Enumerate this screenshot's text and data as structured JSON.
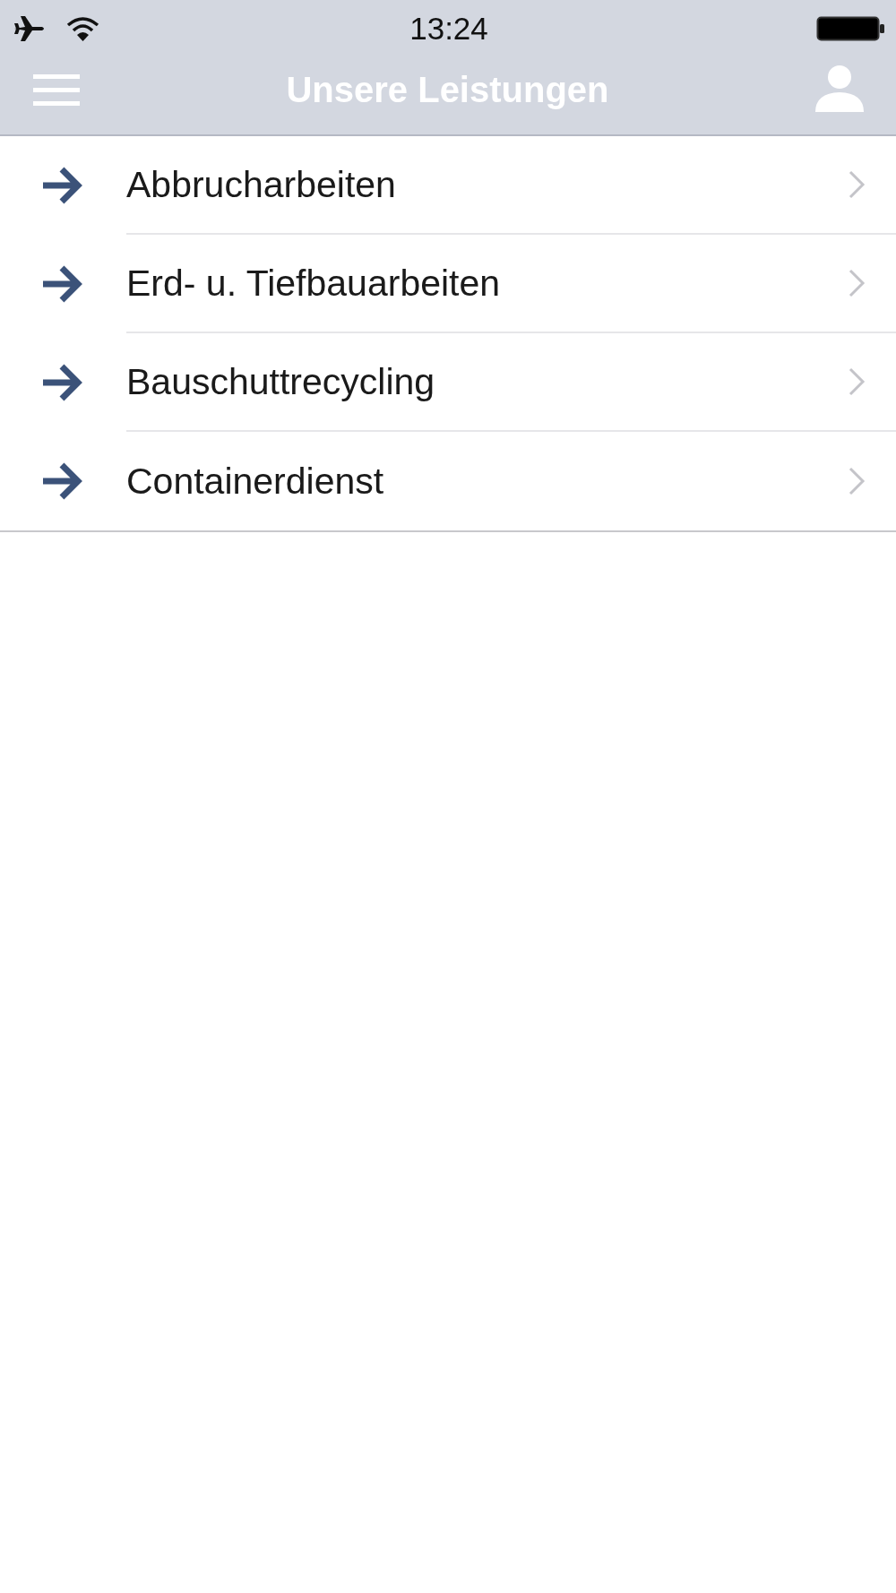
{
  "status_bar": {
    "time": "13:24"
  },
  "nav_bar": {
    "title": "Unsere Leistungen"
  },
  "services": [
    {
      "label": "Abbrucharbeiten"
    },
    {
      "label": "Erd- u. Tiefbauarbeiten"
    },
    {
      "label": "Bauschuttrecycling"
    },
    {
      "label": "Containerdienst"
    }
  ]
}
